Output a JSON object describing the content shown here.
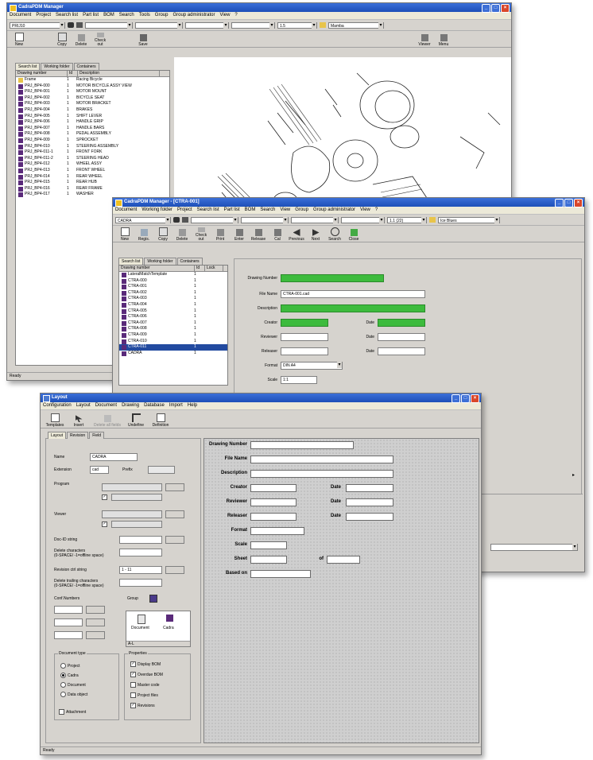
{
  "win1": {
    "title": "CadraPDM Manager",
    "menu": [
      "Document",
      "Project",
      "Search list",
      "Part list",
      "BOM",
      "Search",
      "Tools",
      "Group",
      "Group administrator",
      "View",
      "?"
    ],
    "combo_left": "PRIJ10",
    "combo_mid": "1.5",
    "combo_right": "Mamba",
    "toolbar": [
      "New",
      "Copy",
      "Delete",
      "Check out",
      "Save",
      "Viewer",
      "Menu"
    ],
    "tabs": [
      "Search list",
      "Working folder",
      "Containers"
    ],
    "columns": [
      "Drawing number",
      "Id",
      "Description"
    ],
    "rows": [
      {
        "num": "Frame",
        "id": "1",
        "desc": "Racing Bicycle",
        "folder": true
      },
      {
        "num": "PRJ_BP4-000",
        "id": "1",
        "desc": "MOTOR BICYCLE ASSY VIEW"
      },
      {
        "num": "PRJ_BP4-001",
        "id": "1",
        "desc": "MOTOR MOUNT"
      },
      {
        "num": "PRJ_BP4-002",
        "id": "1",
        "desc": "BICYCLE SEAT"
      },
      {
        "num": "PRJ_BP4-003",
        "id": "1",
        "desc": "MOTOR BRACKET"
      },
      {
        "num": "PRJ_BP4-004",
        "id": "1",
        "desc": "BRAKES"
      },
      {
        "num": "PRJ_BP4-005",
        "id": "1",
        "desc": "SHIFT LEVER"
      },
      {
        "num": "PRJ_BP4-006",
        "id": "1",
        "desc": "HANDLE GRIP"
      },
      {
        "num": "PRJ_BP4-007",
        "id": "1",
        "desc": "HANDLE BARS"
      },
      {
        "num": "PRJ_BP4-008",
        "id": "1",
        "desc": "PEDAL ASSEMBLY"
      },
      {
        "num": "PRJ_BP4-009",
        "id": "1",
        "desc": "SPROCKET"
      },
      {
        "num": "PRJ_BP4-010",
        "id": "1",
        "desc": "STEERING ASSEMBLY"
      },
      {
        "num": "PRJ_BP4-011-1",
        "id": "1",
        "desc": "FRONT FORK"
      },
      {
        "num": "PRJ_BP4-011-2",
        "id": "1",
        "desc": "STEERING HEAD"
      },
      {
        "num": "PRJ_BP4-012",
        "id": "1",
        "desc": "WHEEL ASSY"
      },
      {
        "num": "PRJ_BP4-013",
        "id": "1",
        "desc": "FRONT WHEEL"
      },
      {
        "num": "PRJ_BP4-014",
        "id": "1",
        "desc": "REAR WHEEL"
      },
      {
        "num": "PRJ_BP4-015",
        "id": "1",
        "desc": "REAR HUB"
      },
      {
        "num": "PRJ_BP4-016",
        "id": "1",
        "desc": "REAR FRAME"
      },
      {
        "num": "PRJ_BP4-017",
        "id": "1",
        "desc": "WASHER"
      }
    ],
    "status": "Ready"
  },
  "win2": {
    "title": "CadraPDM Manager - [CTRA-001]",
    "menu": [
      "Document",
      "Working folder",
      "Project",
      "Search list",
      "Part list",
      "BOM",
      "Search",
      "View",
      "Group",
      "Group administrator",
      "View",
      "?"
    ],
    "combo_left": "CADRA",
    "combo_mid": "1.1 (22)",
    "combo_right": "Ice Blues",
    "toolbar": [
      "New",
      "Regis.",
      "Copy",
      "Delete",
      "Check out",
      "Print",
      "Enter",
      "Release",
      "Cal",
      "Previous",
      "Next",
      "Search",
      "Close"
    ],
    "tabs": [
      "Search list",
      "Working folder",
      "Containers"
    ],
    "columns": [
      "Drawing number",
      "Id",
      "Lock"
    ],
    "rows": [
      {
        "num": "LateralMatchTemplate",
        "id": "1"
      },
      {
        "num": "CTRA-000",
        "id": "1"
      },
      {
        "num": "CTRA-001",
        "id": "1"
      },
      {
        "num": "CTRA-002",
        "id": "1"
      },
      {
        "num": "CTRA-003",
        "id": "1"
      },
      {
        "num": "CTRA-004",
        "id": "1"
      },
      {
        "num": "CTRA-005",
        "id": "1"
      },
      {
        "num": "CTRA-006",
        "id": "1"
      },
      {
        "num": "CTRA-007",
        "id": "1"
      },
      {
        "num": "CTRA-008",
        "id": "1"
      },
      {
        "num": "CTRA-009",
        "id": "1"
      },
      {
        "num": "CTRA-010",
        "id": "1"
      },
      {
        "num": "CTRA-011",
        "id": "1",
        "sel": true
      },
      {
        "num": "CADRA",
        "id": "1"
      }
    ],
    "form": {
      "drawing_number_label": "Drawing Number",
      "file_name_label": "File Name",
      "file_name_value": "CTRA-001.cad",
      "description_label": "Description",
      "creator_label": "Creator",
      "reviewer_label": "Reviewer",
      "releaser_label": "Releaser",
      "date_label": "Date",
      "format_label": "Format",
      "format_value": "DIN A4",
      "scale_label": "Scale",
      "scale_value": "1:1"
    }
  },
  "win3": {
    "title": "Layout",
    "menu": [
      "Configuration",
      "Layout",
      "Document",
      "Drawing",
      "Database",
      "Import",
      "Help"
    ],
    "toolbar": [
      "Templates",
      "Insert",
      "Delete all fields",
      "Undefine",
      "Definition"
    ],
    "tabs": [
      "Layout",
      "Revision",
      "Field"
    ],
    "left": {
      "name_label": "Name",
      "name_value": "CADRA",
      "extension_label": "Extension",
      "extension_value": "cad",
      "prefix_label": "Prefix",
      "program_label": "Program",
      "viewer_label": "Viewer",
      "doc_id_label": "Doc-ID string",
      "delete_chars_label": "Delete characters",
      "delete_chars_hint": "(0-SPACE/ -1=offline space)",
      "revision_ctl_label": "Revision ctrl string",
      "revision_ctl_value": "1 - 11",
      "delete_trailing_label": "Delete trailing characters",
      "delete_trailing_hint": "(0-SPACE/ -1=offline space)",
      "conf_numbers_label": "Conf.Numbers",
      "group_label": "Group",
      "doc_type_label": "Document type",
      "doc_types": [
        "Project",
        "Cadra",
        "Document",
        "Data object"
      ],
      "doc_type_selected": 1,
      "properties_label": "Properties",
      "properties": [
        "Display BOM",
        "Overdue BOM",
        "Master code",
        "Project files",
        "Revisions"
      ],
      "properties_checked": [
        0,
        1,
        4
      ],
      "attachment_label": "Attachment",
      "icons": [
        "Document",
        "Cadra"
      ],
      "slider_value": "A-L"
    },
    "form_labels": [
      "Drawing Number",
      "File Name",
      "Description",
      "Creator",
      "Reviewer",
      "Releaser",
      "Format",
      "Scale",
      "Sheet",
      "Based on"
    ],
    "date_label": "Date",
    "of_label": "of",
    "status": "Ready"
  }
}
